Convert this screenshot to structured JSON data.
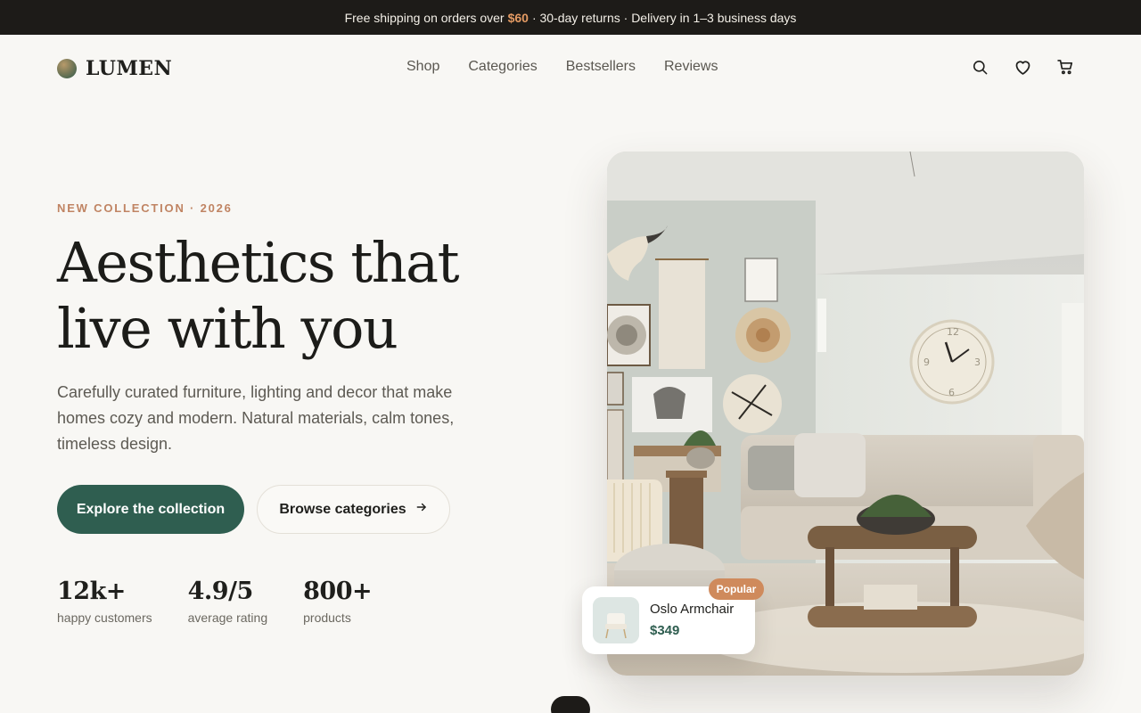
{
  "announcement": {
    "before": "Free shipping on orders over",
    "price": "$60",
    "after": "· 30-day returns · Delivery in 1–3 business days"
  },
  "brand": {
    "name": "LUMEN"
  },
  "nav": {
    "items": [
      "Shop",
      "Categories",
      "Bestsellers",
      "Reviews"
    ]
  },
  "header_icons": [
    "search-icon",
    "heart-icon",
    "cart-icon"
  ],
  "hero": {
    "eyebrow": "NEW COLLECTION · 2026",
    "headline_line1": "Aesthetics that",
    "headline_line2": "live with you",
    "description": "Carefully curated furniture, lighting and decor that make homes cozy and modern. Natural materials, calm tones, timeless design.",
    "primary_cta": "Explore the collection",
    "secondary_cta": "Browse categories"
  },
  "stats": [
    {
      "value": "12k+",
      "label": "happy customers"
    },
    {
      "value": "4.9/5",
      "label": "average rating"
    },
    {
      "value": "800+",
      "label": "products"
    }
  ],
  "product_card": {
    "badge": "Popular",
    "name": "Oslo Armchair",
    "price": "$349"
  },
  "colors": {
    "accent": "#2f5e50",
    "eyebrow": "#c08463",
    "badge": "#cf8a5c",
    "announcement_bg": "#1d1b18",
    "page_bg": "#f8f7f4"
  }
}
